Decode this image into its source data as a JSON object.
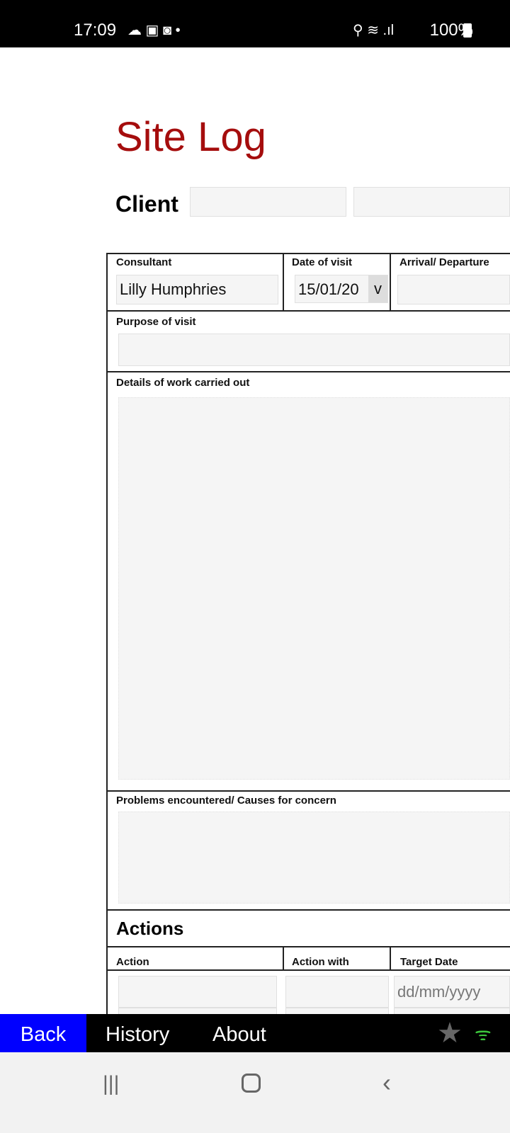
{
  "status_bar": {
    "time": "17:09",
    "battery": "100%"
  },
  "form": {
    "title": "Site Log",
    "client_label": "Client",
    "consultant_label": "Consultant",
    "consultant_value": "Lilly Humphries",
    "date_label": "Date  of visit",
    "date_value": "15/01/20",
    "date_dropdown": "v",
    "arrival_label": "Arrival/ Departure",
    "purpose_label": "Purpose of visit",
    "details_label": "Details of work carried out",
    "problems_label": "Problems encountered/ Causes for concern",
    "actions_heading": "Actions",
    "actions_columns": [
      "Action",
      "Action with",
      "Target Date"
    ],
    "target_date_placeholder": "dd/mm/yyyy"
  },
  "bottom_bar": {
    "back": "Back",
    "history": "History",
    "about": "About",
    "back_color": "#0000ff",
    "wifi_color": "#3cc83c"
  }
}
